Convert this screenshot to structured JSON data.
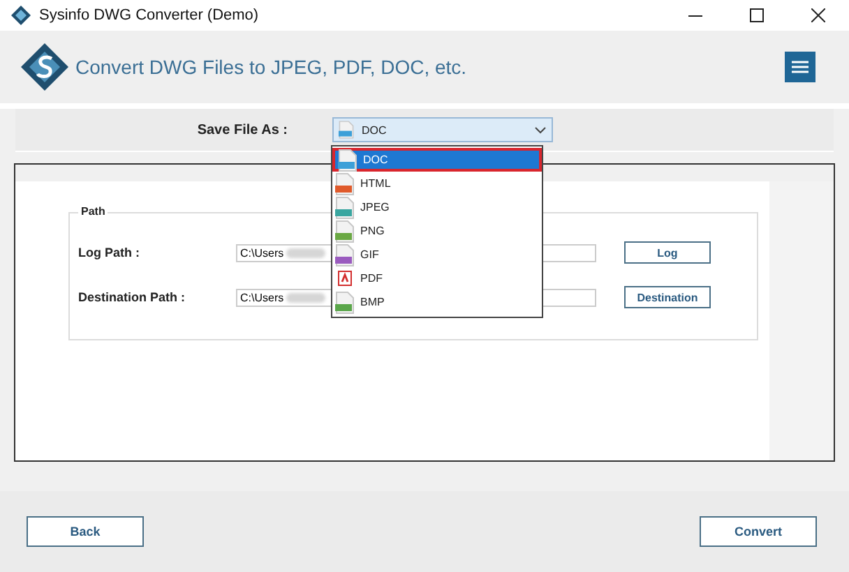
{
  "window": {
    "title": "Sysinfo DWG Converter (Demo)"
  },
  "header": {
    "title": "Convert DWG Files to JPEG, PDF, DOC, etc."
  },
  "save_as": {
    "label": "Save File As :",
    "value": "DOC",
    "expanded": true,
    "options": [
      {
        "label": "DOC",
        "kind": "doc",
        "selected": true
      },
      {
        "label": "HTML",
        "kind": "html",
        "selected": false
      },
      {
        "label": "JPEG",
        "kind": "jpeg",
        "selected": false
      },
      {
        "label": "PNG",
        "kind": "png",
        "selected": false
      },
      {
        "label": "GIF",
        "kind": "gif",
        "selected": false
      },
      {
        "label": "PDF",
        "kind": "pdf",
        "selected": false
      },
      {
        "label": "BMP",
        "kind": "bmp",
        "selected": false
      }
    ]
  },
  "path_group": {
    "title": "Path",
    "rows": [
      {
        "label": "Log Path :",
        "value": "C:\\Users",
        "button": "Log"
      },
      {
        "label": "Destination Path :",
        "value": "C:\\Users",
        "button": "Destination"
      }
    ]
  },
  "buttons": [
    "Back",
    "Convert"
  ]
}
